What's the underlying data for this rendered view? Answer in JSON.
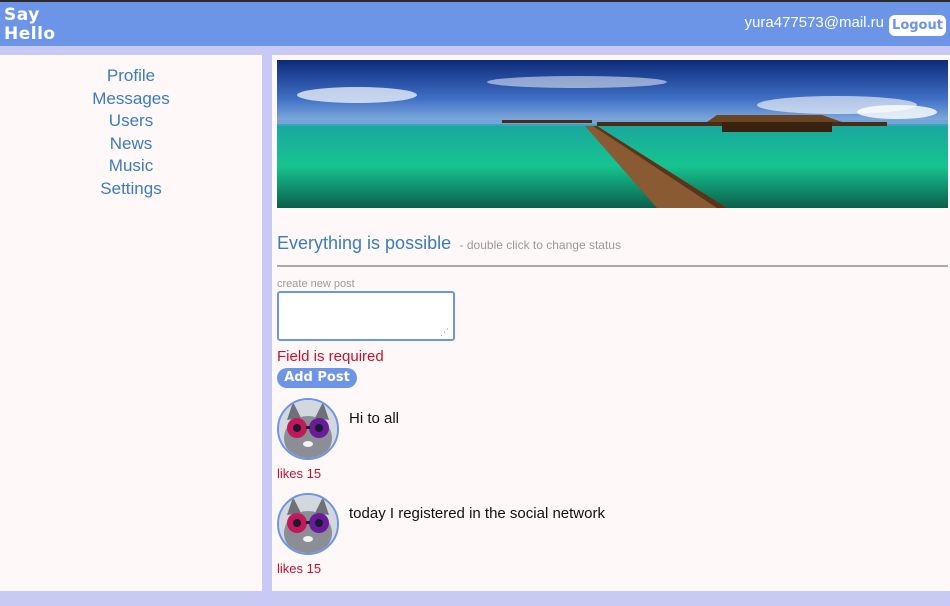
{
  "header": {
    "logo": "Say Hello",
    "email": "yura477573@mail.ru",
    "logout_label": "Logout"
  },
  "sidebar": {
    "items": [
      {
        "label": "Profile"
      },
      {
        "label": "Messages"
      },
      {
        "label": "Users"
      },
      {
        "label": "News"
      },
      {
        "label": "Music"
      },
      {
        "label": "Settings"
      }
    ]
  },
  "profile": {
    "status": "Everything is possible",
    "status_hint": "- double click to change status",
    "new_post_label": "create new post",
    "new_post_value": "",
    "error": "Field is required",
    "add_post_label": "Add Post"
  },
  "posts": [
    {
      "text": "Hi to all",
      "likes": "likes 15"
    },
    {
      "text": "today I registered in the social network",
      "likes": "likes 15"
    }
  ],
  "colors": {
    "header": "#6c95e8",
    "background": "#c9c9f5",
    "panel": "#fff8f8",
    "link": "#3b7bc4",
    "error": "#c8102e"
  }
}
